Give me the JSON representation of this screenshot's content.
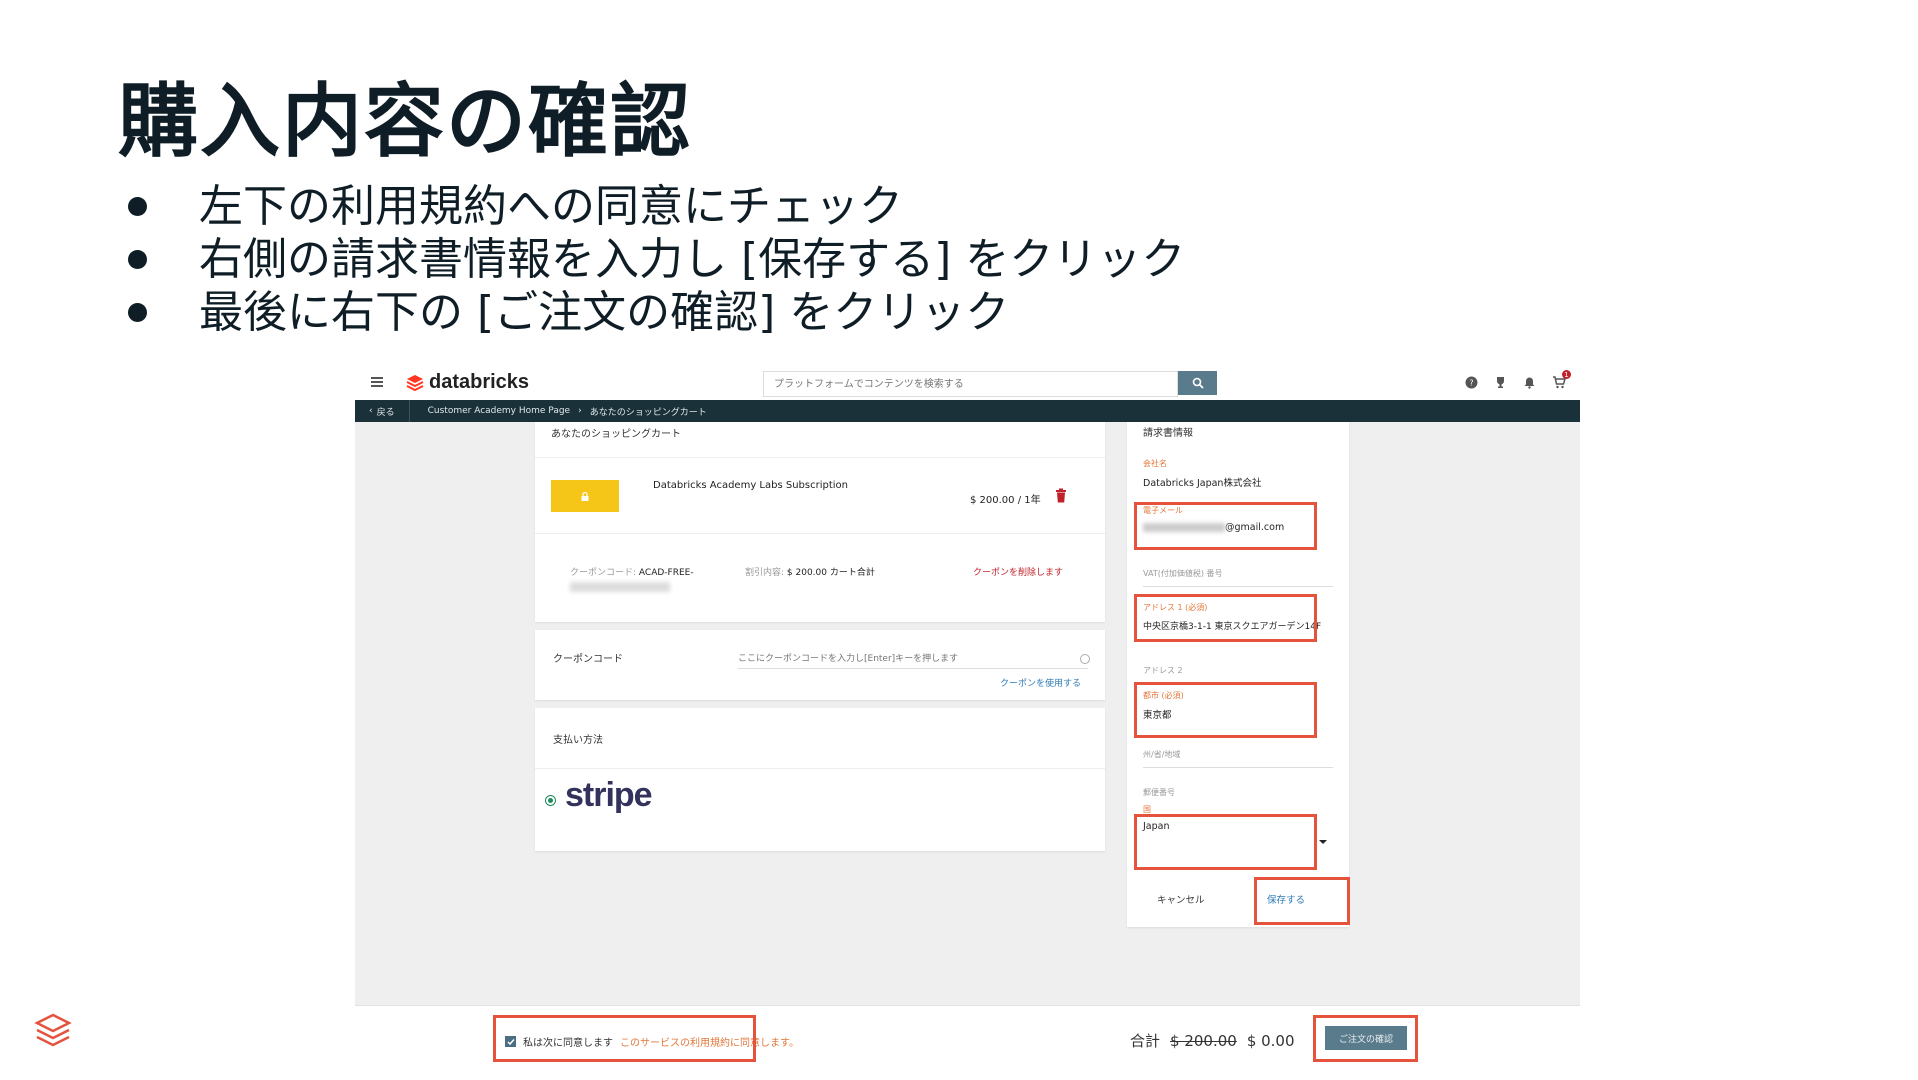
{
  "slide": {
    "title": "購入内容の確認",
    "bullets": [
      "左下の利用規約への同意にチェック",
      "右側の請求書情報を入力し [保存する] をクリック",
      "最後に右下の [ご注文の確認] をクリック"
    ]
  },
  "app": {
    "brand": "databricks",
    "search_placeholder": "プラットフォームでコンテンツを検索する",
    "cart_count": "1"
  },
  "nav": {
    "back": "戻る",
    "breadcrumbs": [
      "Customer Academy Home Page",
      "あなたのショッピングカート"
    ]
  },
  "cart": {
    "heading": "あなたのショッピングカート",
    "item_name": "Databricks Academy Labs Subscription",
    "item_price": "$ 200.00 / 1年",
    "coupon_label": "クーポンコード:",
    "coupon_code": "ACAD-FREE-",
    "discount_label": "割引内容:",
    "discount_value": "$ 200.00 カート合計",
    "remove_coupon": "クーポンを削除します"
  },
  "coupon": {
    "title": "クーポンコード",
    "placeholder": "ここにクーポンコードを入力し[Enter]キーを押します",
    "apply": "クーポンを使用する"
  },
  "payment": {
    "title": "支払い方法",
    "provider": "stripe"
  },
  "billing": {
    "heading": "請求書情報",
    "company_label": "会社名",
    "company_value": "Databricks Japan株式会社",
    "email_label": "電子メール",
    "email_suffix": "@gmail.com",
    "vat_label": "VAT(付加価値税) 番号",
    "address1_label": "アドレス 1 (必須)",
    "address1_value": "中央区京橋3-1-1 東京スクエアガーデン14F",
    "address2_label": "アドレス 2",
    "city_label": "都市 (必須)",
    "city_value": "東京都",
    "state_label": "州/省/地域",
    "postal_label": "郵便番号",
    "country_label": "国",
    "country_value": "Japan",
    "cancel": "キャンセル",
    "save": "保存する"
  },
  "footer": {
    "agree_text": "私は次に同意します",
    "agree_link": "このサービスの利用規約に同意します。",
    "total_label": "合計",
    "old_total": "$ 200.00",
    "new_total": "$ 0.00",
    "confirm": "ご注文の確認"
  },
  "colors": {
    "highlight": "#e5533d",
    "navbar": "#1b3139",
    "accent_orange": "#e2773b",
    "button": "#5a7b8c"
  }
}
